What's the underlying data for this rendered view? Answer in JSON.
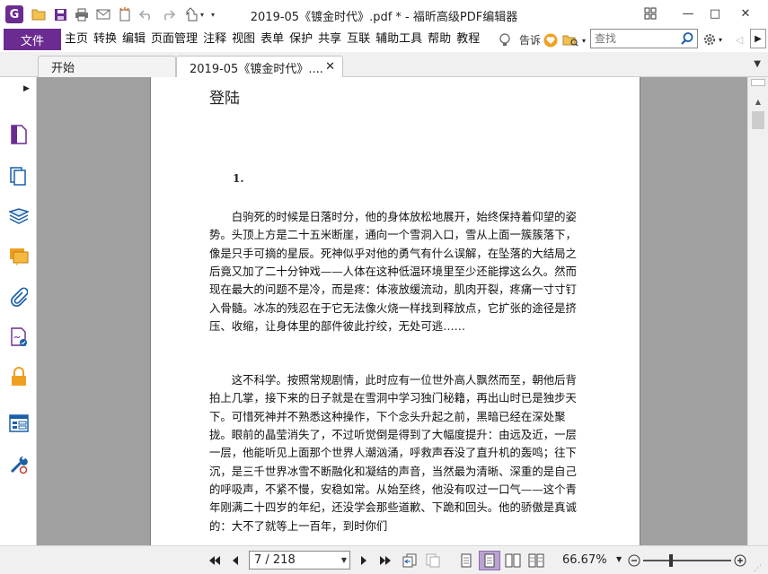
{
  "window": {
    "title": "2019-05《镀金时代》.pdf * - 福昕高级PDF编辑器",
    "minimize": "—",
    "maximize": "□",
    "close": "✕",
    "restore": "⧉"
  },
  "menu": {
    "file": "文件",
    "items": [
      "主页",
      "转换",
      "编辑",
      "页面管理",
      "注释",
      "视图",
      "表单",
      "保护",
      "共享",
      "互联",
      "辅助工具",
      "帮助",
      "教程"
    ],
    "tell_me": "告诉",
    "search_placeholder": "查找"
  },
  "tabs": [
    {
      "label": "开始"
    },
    {
      "label": "2019-05《镀金时代》....",
      "close": "✕"
    }
  ],
  "document": {
    "heading": "登陆",
    "chapter": "1.",
    "paragraphs": [
      "白驹死的时候是日落时分，他的身体放松地展开，始终保持着仰望的姿势。头顶上方是二十五米断崖，通向一个雪洞入口，雪从上面一簇簇落下，像是只手可摘的星辰。死神似乎对他的勇气有什么误解，在坠落的大结局之后竟又加了二十分钟戏——人体在这种低温环境里至少还能撑这么久。然而现在最大的问题不是冷，而是疼：体液放缓流动，肌肉开裂，疼痛一寸寸钉入骨髓。冰冻的残忍在于它无法像火烧一样找到释放点，它扩张的途径是挤压、收缩，让身体里的部件彼此拧绞，无处可逃……",
      "这不科学。按照常规剧情，此时应有一位世外高人飘然而至，朝他后背拍上几掌，接下来的日子就是在雪洞中学习独门秘籍，再出山时已是独步天下。可惜死神并不熟悉这种操作，下个念头升起之前，黑暗已经在深处聚拢。眼前的晶莹消失了，不过听觉倒是得到了大幅度提升：由远及近，一层一层，他能听见上面那个世界人潮汹涌，呼救声吞没了直升机的轰鸣；往下沉，是三千世界冰雪不断融化和凝结的声音，当然最为清晰、深重的是自己的呼吸声，不紧不慢，安稳如常。从始至终，他没有叹过一口气——这个青年刚满二十四岁的年纪，还没学会那些道歉、下跪和回头。他的骄傲是真诚的：大不了就等上一百年，到时你们"
    ]
  },
  "status": {
    "page": "7 / 218",
    "zoom": "66.67%"
  },
  "colors": {
    "accent": "#6b2c91",
    "doc_background": "#a0a0a0"
  }
}
